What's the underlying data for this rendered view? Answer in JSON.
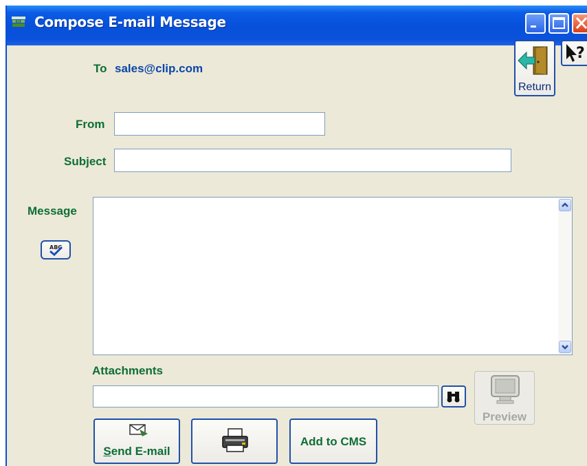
{
  "window": {
    "title": "Compose E-mail Message"
  },
  "title_buttons": {
    "minimize": "minimize-icon",
    "maximize": "maximize-icon",
    "close": "close-icon"
  },
  "to": {
    "prefix": "To",
    "address": "sales@clip.com"
  },
  "return_button": {
    "label": "Return",
    "icon": "exit-door-icon"
  },
  "help_button": {
    "icon": "context-help-icon"
  },
  "from": {
    "label": "From",
    "value": ""
  },
  "subject": {
    "label": "Subject",
    "value": ""
  },
  "message": {
    "label": "Message",
    "value": "",
    "spellcheck_icon": "spellcheck-icon"
  },
  "attachments": {
    "label": "Attachments",
    "value": "",
    "browse_icon": "binoculars-icon"
  },
  "preview_button": {
    "label": "Preview",
    "enabled": false,
    "icon": "monitor-icon"
  },
  "actions": {
    "send_label": "Send E-mail",
    "send_mnemonic": "S",
    "send_rest": "end E-mail",
    "print_icon": "printer-icon",
    "add_cms_label": "Add to CMS"
  },
  "colors": {
    "title_bar": "#0a52dc",
    "label_green": "#0e6e35",
    "address_blue": "#0b46a8",
    "window_bg": "#ece9d8"
  }
}
